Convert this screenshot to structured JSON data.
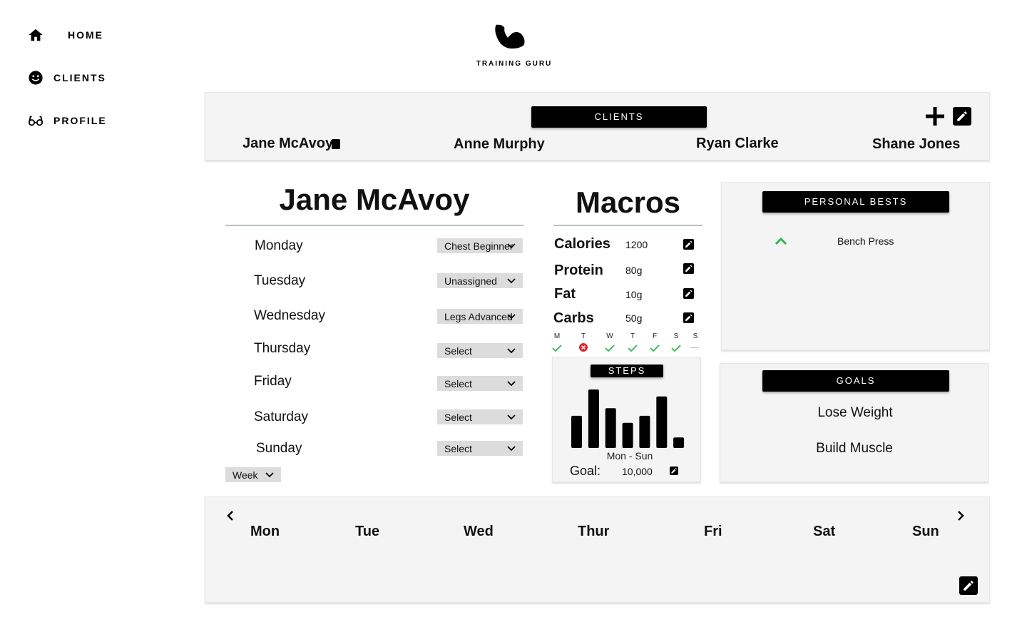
{
  "app": {
    "logo_text": "TRAINING GURU"
  },
  "sidebar": {
    "items": [
      {
        "label": "HOME",
        "icon": "home-icon"
      },
      {
        "label": "CLIENTS",
        "icon": "smiley-icon"
      },
      {
        "label": "PROFILE",
        "icon": "glasses-icon"
      }
    ]
  },
  "clients_panel": {
    "title": "CLIENTS",
    "clients": [
      "Jane McAvoy",
      "Anne Murphy",
      "Ryan Clarke",
      "Shane Jones"
    ]
  },
  "schedule": {
    "client_name": "Jane McAvoy",
    "days": [
      {
        "day": "Monday",
        "workout": "Chest Beginner"
      },
      {
        "day": "Tuesday",
        "workout": "Unassigned"
      },
      {
        "day": "Wednesday",
        "workout": "Legs Advanced"
      },
      {
        "day": "Thursday",
        "workout": "Select"
      },
      {
        "day": "Friday",
        "workout": "Select"
      },
      {
        "day": "Saturday",
        "workout": "Select"
      },
      {
        "day": "Sunday",
        "workout": "Select"
      }
    ],
    "range_select": "Week"
  },
  "macros": {
    "title": "Macros",
    "items": [
      {
        "label": "Calories",
        "value": "1200"
      },
      {
        "label": "Protein",
        "value": "80g"
      },
      {
        "label": "Fat",
        "value": "10g"
      },
      {
        "label": "Carbs",
        "value": "50g"
      }
    ],
    "week_tracker": [
      {
        "letter": "M",
        "status": "done"
      },
      {
        "letter": "T",
        "status": "missed"
      },
      {
        "letter": "W",
        "status": "done"
      },
      {
        "letter": "T",
        "status": "done"
      },
      {
        "letter": "F",
        "status": "done"
      },
      {
        "letter": "S",
        "status": "done"
      },
      {
        "letter": "S",
        "status": "none"
      }
    ],
    "colors": {
      "done": "#2db84d",
      "missed": "#e0262c",
      "none": "#bbbbbb"
    }
  },
  "steps": {
    "title": "STEPS",
    "caption": "Mon - Sun",
    "goal_label": "Goal:",
    "goal_value": "10,000"
  },
  "chart_data": {
    "type": "bar",
    "categories": [
      "Mon",
      "Tue",
      "Wed",
      "Thu",
      "Fri",
      "Sat",
      "Sun"
    ],
    "values": [
      5500,
      10000,
      6800,
      4300,
      5500,
      8800,
      1800
    ],
    "title": "STEPS",
    "xlabel": "Mon - Sun",
    "ylabel": "",
    "ylim": [
      0,
      10000
    ]
  },
  "personal_bests": {
    "title": "PERSONAL BESTS",
    "items": [
      {
        "name": "Bench Press",
        "trend": "up",
        "color": "#2db84d"
      }
    ]
  },
  "goals": {
    "title": "GOALS",
    "items": [
      "Lose Weight",
      "Build Muscle"
    ]
  },
  "week_view": {
    "days": [
      "Mon",
      "Tue",
      "Wed",
      "Thur",
      "Fri",
      "Sat",
      "Sun"
    ]
  }
}
